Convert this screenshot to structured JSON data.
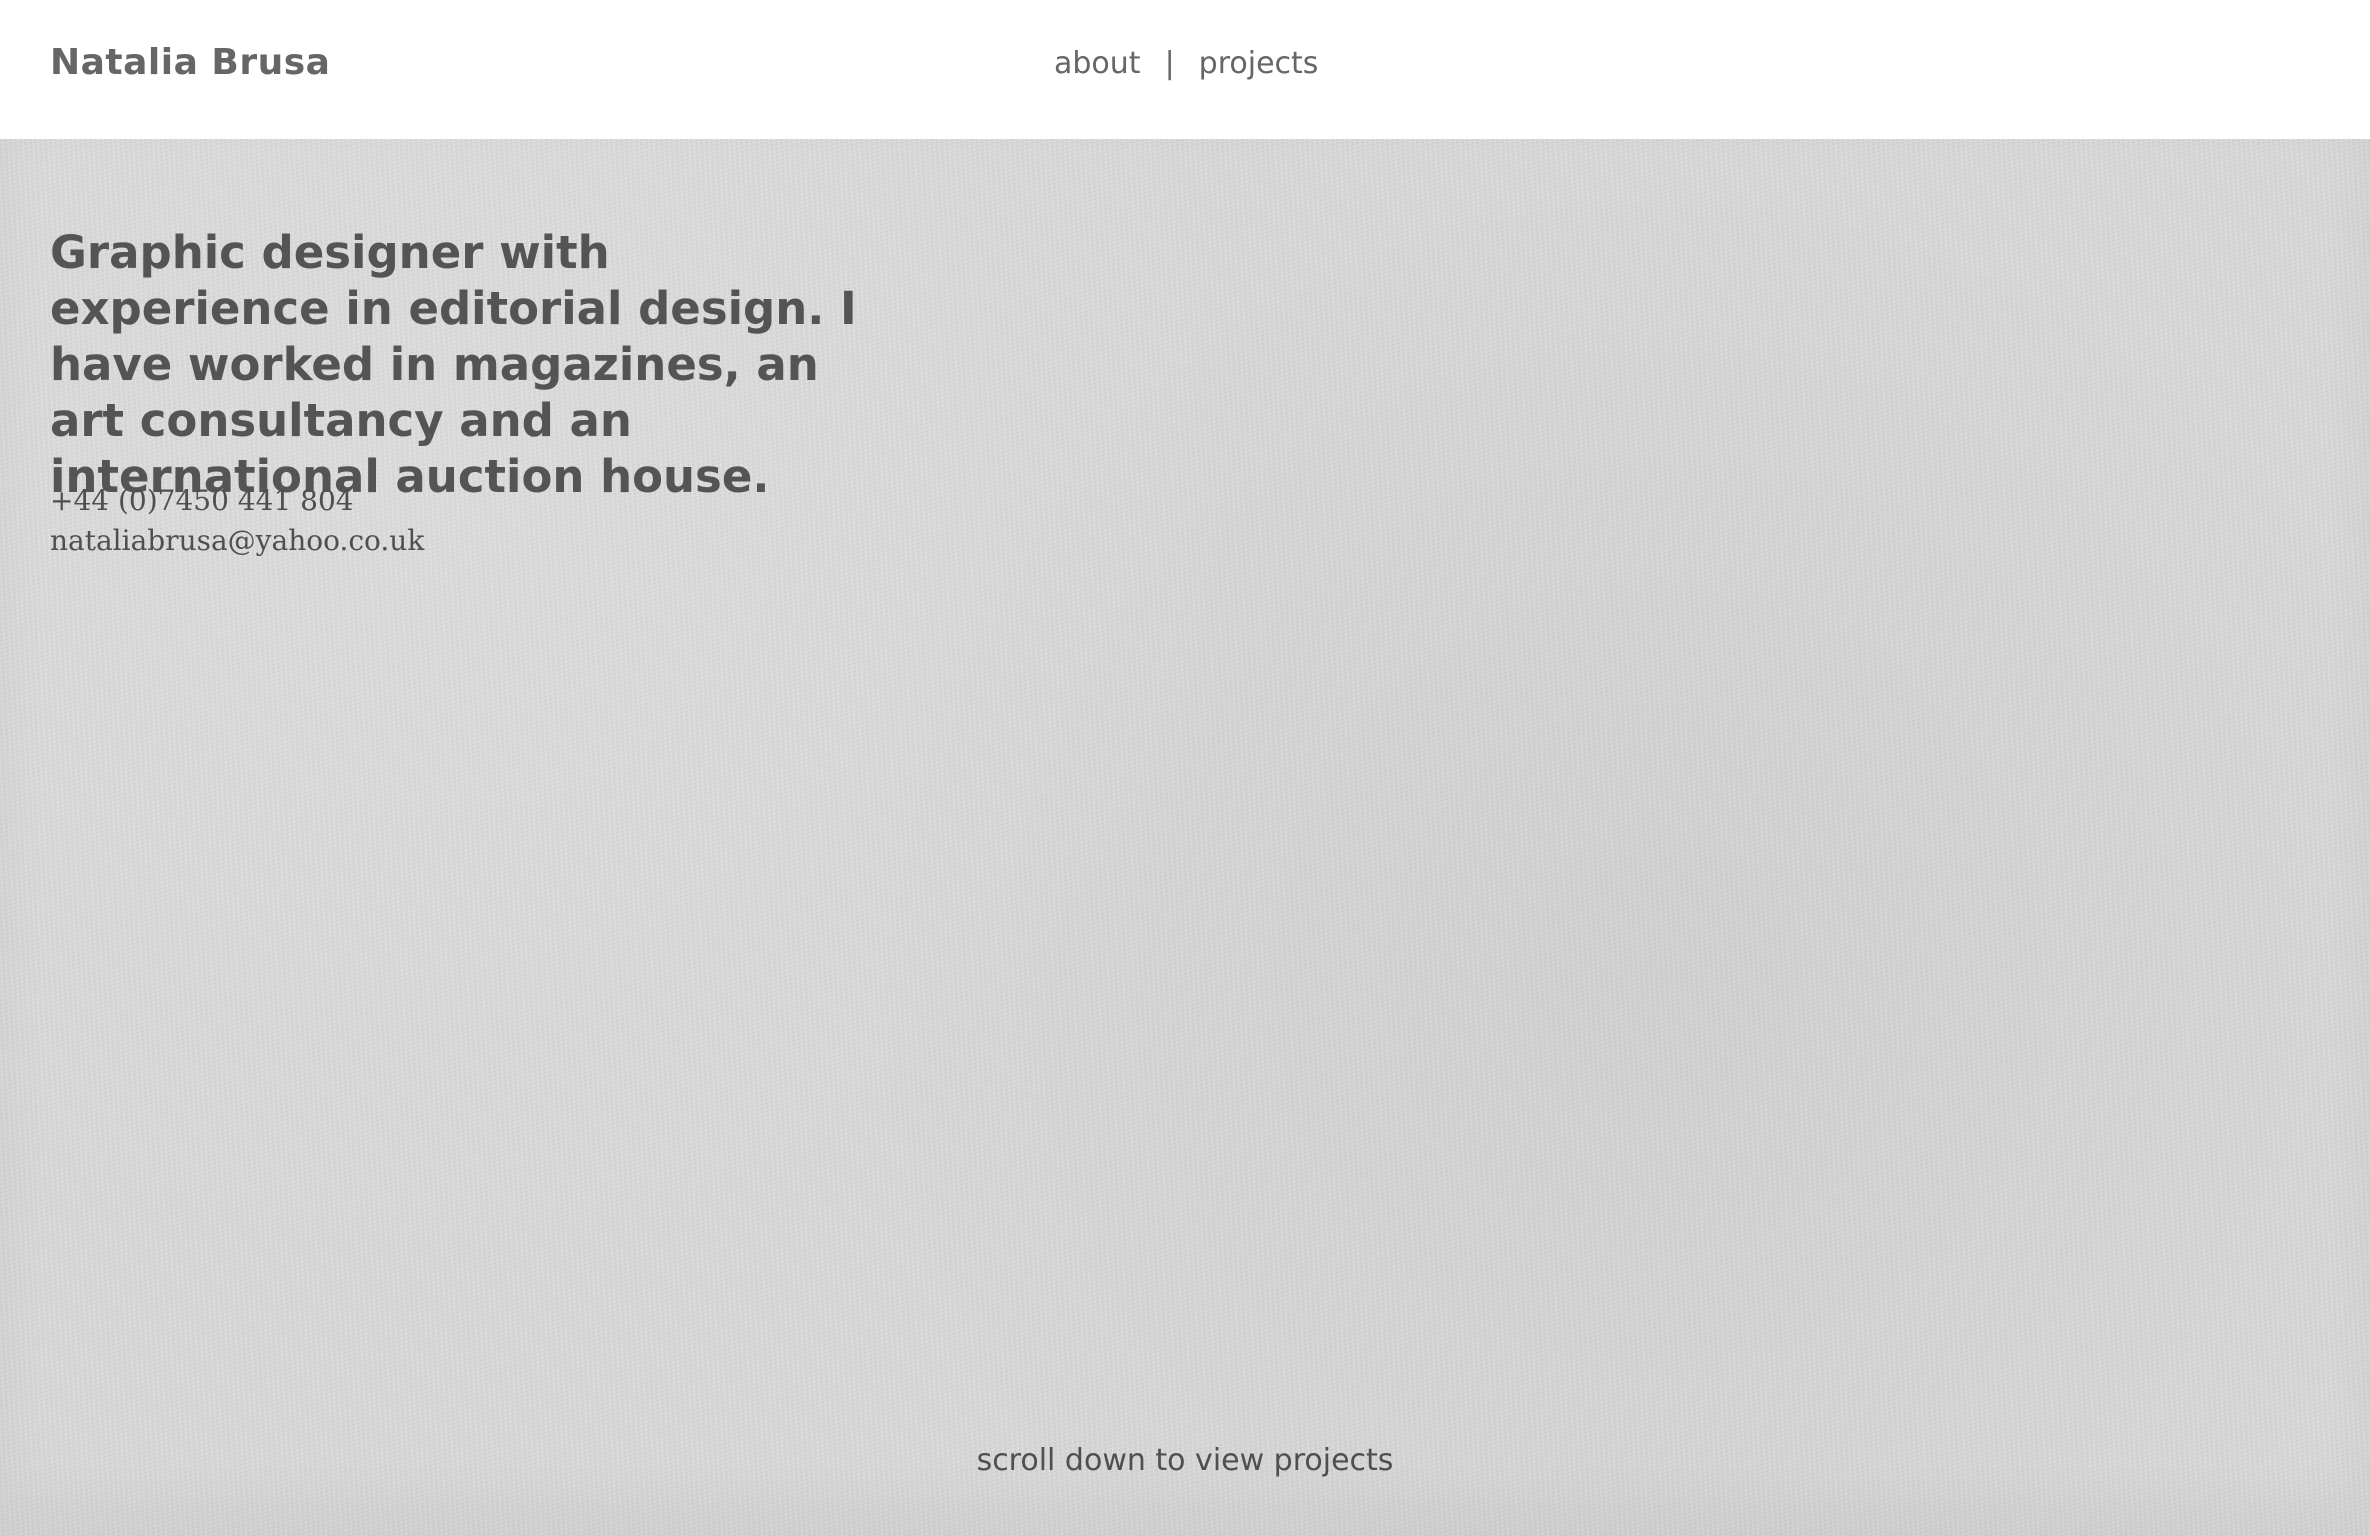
{
  "header": {
    "site_title": "Natalia Brusa",
    "nav": {
      "about": "about",
      "separator": "|",
      "projects": "projects"
    }
  },
  "main": {
    "bio": "Graphic designer with experience in editorial design. I have worked in magazines, an art consultancy and an international auction house.",
    "contact": {
      "phone": "+44 (0)7450 441 804",
      "email": "nataliabrusa@yahoo.co.uk"
    },
    "scroll_hint": "scroll down to view projects"
  },
  "colors": {
    "header_background": "#ffffff",
    "paper_background": "#d8d8d8",
    "text": "#585858"
  }
}
